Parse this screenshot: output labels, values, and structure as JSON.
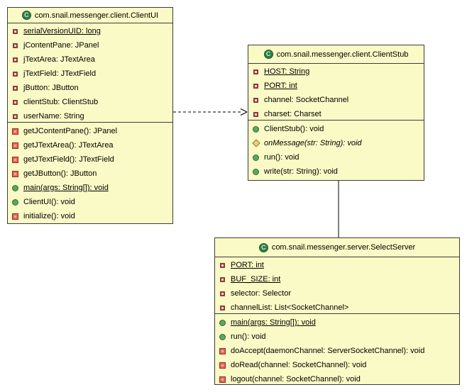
{
  "diagram": {
    "type": "uml-class-diagram",
    "class_badge_letter": "C",
    "colors": {
      "background": "#ffffff",
      "box_fill": "#fafac6",
      "border": "#3c3c3c",
      "public_green": "#5fa463",
      "private_red": "#e8685c",
      "protected_yellow": "#edcd7e",
      "class_badge_green": "#2e7d46"
    },
    "icons": {
      "class-icon": "green circle with letter C",
      "private-field": "small dark-red square outline",
      "private-method": "red filled square",
      "public-method": "green filled circle",
      "protected-method": "yellow diamond"
    }
  },
  "classes": [
    {
      "name": "com.snail.messenger.client.ClientUI",
      "fields": [
        {
          "text": "serialVersionUID: long",
          "icon": "private-field",
          "static": true
        },
        {
          "text": "jContentPane: JPanel",
          "icon": "private-field"
        },
        {
          "text": "jTextArea: JTextArea",
          "icon": "private-field"
        },
        {
          "text": "jTextField: JTextField",
          "icon": "private-field"
        },
        {
          "text": "jButton: JButton",
          "icon": "private-field"
        },
        {
          "text": "clientStub: ClientStub",
          "icon": "private-field"
        },
        {
          "text": "userName: String",
          "icon": "private-field"
        }
      ],
      "methods": [
        {
          "text": "getJContentPane(): JPanel",
          "icon": "private-method"
        },
        {
          "text": "getJTextArea(): JTextArea",
          "icon": "private-method"
        },
        {
          "text": "getJTextField(): JTextField",
          "icon": "private-method"
        },
        {
          "text": "getJButton(): JButton",
          "icon": "private-method"
        },
        {
          "text": "main(args: String[]): void",
          "icon": "public-method",
          "static": true
        },
        {
          "text": "ClientUI(): void",
          "icon": "public-method"
        },
        {
          "text": "initialize(): void",
          "icon": "private-method"
        }
      ]
    },
    {
      "name": "com.snail.messenger.client.ClientStub",
      "fields": [
        {
          "text": "HOST: String",
          "icon": "private-field",
          "static": true
        },
        {
          "text": "PORT: int",
          "icon": "private-field",
          "static": true
        },
        {
          "text": "channel: SocketChannel",
          "icon": "private-field"
        },
        {
          "text": "charset: Charset",
          "icon": "private-field"
        }
      ],
      "methods": [
        {
          "text": "ClientStub(): void",
          "icon": "public-method"
        },
        {
          "text": "onMessage(str: String): void",
          "icon": "protected-method",
          "abstract": true
        },
        {
          "text": "run(): void",
          "icon": "public-method"
        },
        {
          "text": "write(str: String): void",
          "icon": "public-method"
        }
      ]
    },
    {
      "name": "com.snail.messenger.server.SelectServer",
      "fields": [
        {
          "text": "PORT: int",
          "icon": "private-field",
          "static": true
        },
        {
          "text": "BUF_SIZE: int",
          "icon": "private-field",
          "static": true
        },
        {
          "text": "selector: Selector",
          "icon": "private-field"
        },
        {
          "text": "channelList: List<SocketChannel>",
          "icon": "private-field"
        }
      ],
      "methods": [
        {
          "text": "main(args: String[]): void",
          "icon": "public-method",
          "static": true
        },
        {
          "text": "run(): void",
          "icon": "public-method"
        },
        {
          "text": "doAccept(daemonChannel: ServerSocketChannel): void",
          "icon": "private-method"
        },
        {
          "text": "doRead(channel: SocketChannel): void",
          "icon": "private-method"
        },
        {
          "text": "logout(channel: SocketChannel): void",
          "icon": "private-method"
        }
      ]
    }
  ],
  "connectors": [
    {
      "from": "ClientUI",
      "to": "ClientStub",
      "type": "dependency",
      "line": "dashed",
      "arrow": "open"
    },
    {
      "from": "ClientStub",
      "to": "SelectServer",
      "type": "association",
      "line": "solid",
      "arrow": "none"
    }
  ]
}
